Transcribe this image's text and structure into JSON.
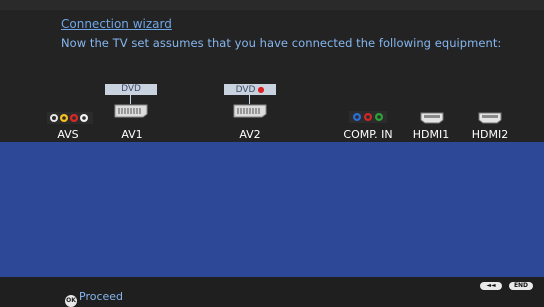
{
  "wizard": {
    "title": "Connection wizard",
    "instruction": "Now the TV set assumes that you have connected the following equipment:"
  },
  "ports": [
    {
      "label": "AVS",
      "type": "avs"
    },
    {
      "label": "AV1",
      "type": "scart",
      "device": "DVD"
    },
    {
      "label": "AV2",
      "type": "scart",
      "device": "DVD",
      "device_indicator": "red-dot"
    },
    {
      "label": "COMP. IN",
      "type": "component"
    },
    {
      "label": "HDMI1",
      "type": "hdmi"
    },
    {
      "label": "HDMI2",
      "type": "hdmi"
    }
  ],
  "footer": {
    "ok_icon": "OK",
    "proceed": "Proceed",
    "back_button": "◄◄",
    "end_button": "END"
  },
  "colors": {
    "background": "#232323",
    "panel": "#2e4898",
    "link": "#6fa6e6",
    "text": "#86b7ef",
    "tag": "#c9d2df",
    "tag_indicator": "#d22222"
  },
  "icons": {
    "avs": "avs-connector-icon",
    "scart": "scart-connector-icon",
    "component": "component-rgb-connector-icon",
    "hdmi": "hdmi-connector-icon",
    "ok": "ok-button-icon"
  }
}
